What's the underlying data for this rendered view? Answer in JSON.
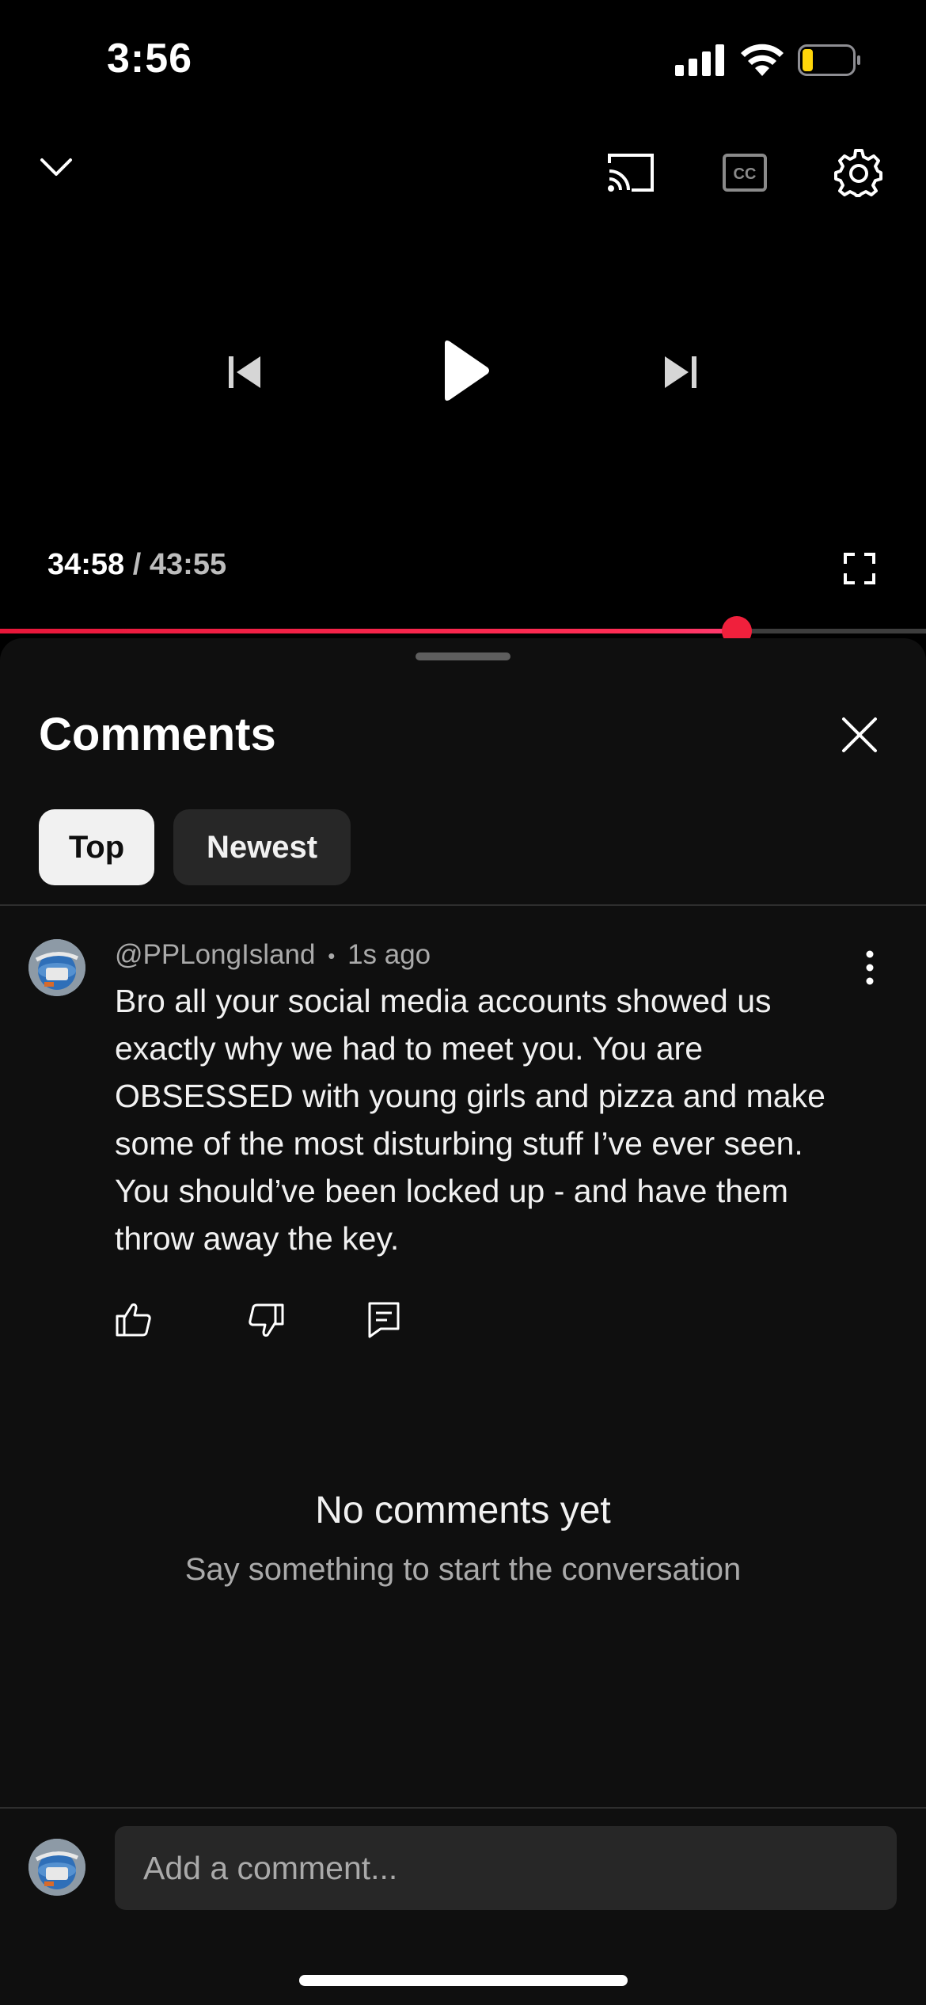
{
  "status_bar": {
    "time": "3:56",
    "icons": [
      "cellular-signal-icon",
      "wifi-icon",
      "battery-low-icon"
    ],
    "battery_color": "#ffd60a"
  },
  "player": {
    "current_time": "34:58",
    "separator": "/",
    "duration": "43:55",
    "progress_fraction": 0.796,
    "progress_color": "#ff0033",
    "icons": [
      "collapse-chevron-icon",
      "cast-icon",
      "captions-icon",
      "settings-gear-icon",
      "previous-icon",
      "play-icon",
      "next-icon",
      "fullscreen-icon"
    ]
  },
  "comments": {
    "title": "Comments",
    "sort_chips": [
      {
        "label": "Top",
        "active": true
      },
      {
        "label": "Newest",
        "active": false
      }
    ],
    "items": [
      {
        "author": "@PPLongIsland",
        "dot": "•",
        "time": "1s ago",
        "text": "Bro all your social media accounts showed us exactly why we had to meet you. You are OBSESSED with young girls and pizza and make some of the most disturbing stuff I’ve ever seen. You should’ve been locked up - and have them throw away the key."
      }
    ],
    "empty_title": "No comments yet",
    "empty_subtitle": "Say something to start the conversation",
    "input_placeholder": "Add a comment..."
  }
}
